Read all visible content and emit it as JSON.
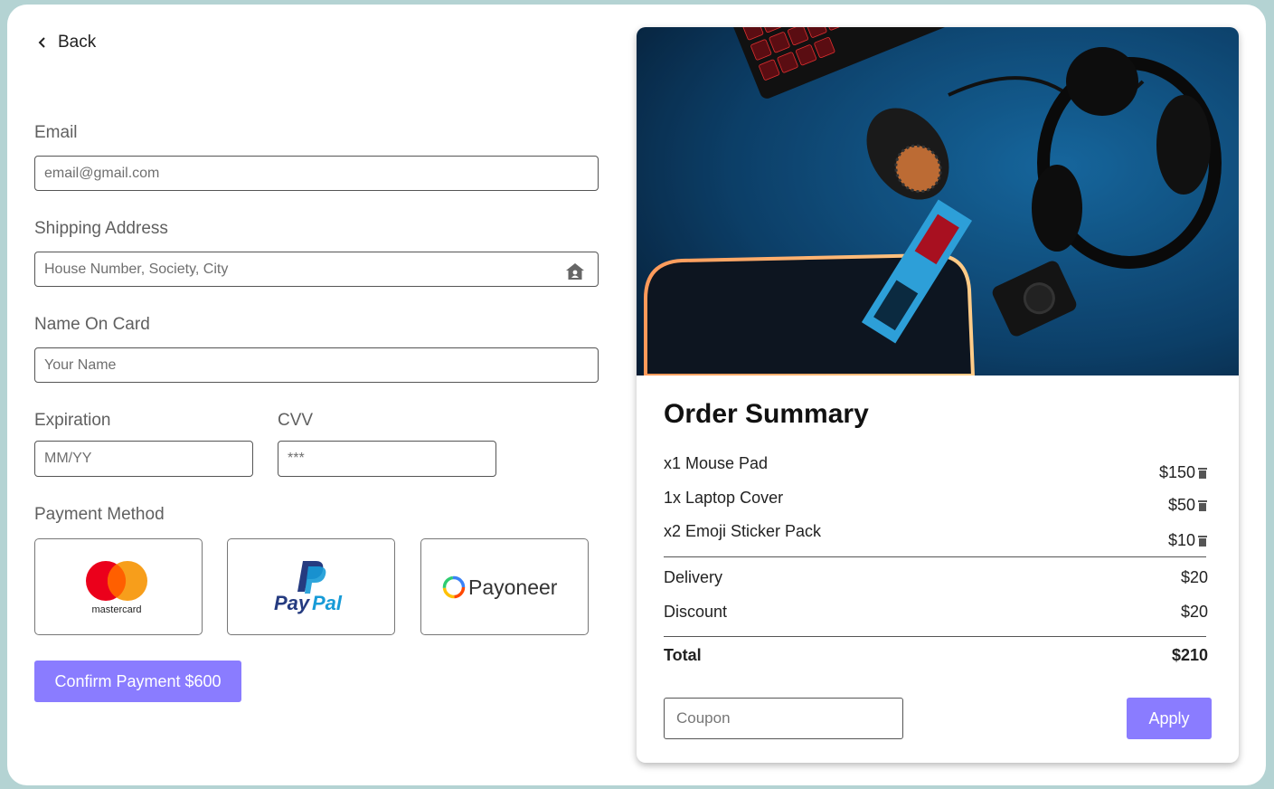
{
  "nav": {
    "back_label": "Back"
  },
  "form": {
    "email": {
      "label": "Email",
      "placeholder": "email@gmail.com"
    },
    "address": {
      "label": "Shipping Address",
      "placeholder": "House Number, Society, City"
    },
    "name_on_card": {
      "label": "Name On Card",
      "placeholder": "Your Name"
    },
    "expiration": {
      "label": "Expiration",
      "placeholder": "MM/YY"
    },
    "cvv": {
      "label": "CVV",
      "placeholder": "***"
    },
    "payment_method": {
      "label": "Payment Method",
      "options": [
        {
          "name": "mastercard",
          "text": "mastercard"
        },
        {
          "name": "paypal",
          "text_a": "Pay",
          "text_b": "Pal"
        },
        {
          "name": "payoneer",
          "text": "Payoneer"
        }
      ]
    },
    "confirm_label": "Confirm Payment $600"
  },
  "order_summary": {
    "title": "Order Summary",
    "items": [
      {
        "name": "x1 Mouse Pad",
        "price": "$150"
      },
      {
        "name": "1x Laptop Cover",
        "price": "$50"
      },
      {
        "name": "x2 Emoji Sticker Pack",
        "price": "$10"
      }
    ],
    "delivery": {
      "label": "Delivery",
      "value": "$20"
    },
    "discount": {
      "label": "Discount",
      "value": "$20"
    },
    "total": {
      "label": "Total",
      "value": "$210"
    },
    "coupon_placeholder": "Coupon",
    "apply_label": "Apply"
  },
  "colors": {
    "background": "#b4d3d3",
    "accent": "#8a7cff",
    "mastercard_red": "#eb001b",
    "mastercard_orange": "#f79e1b",
    "paypal_dark": "#253b80",
    "paypal_light": "#179bd7"
  }
}
